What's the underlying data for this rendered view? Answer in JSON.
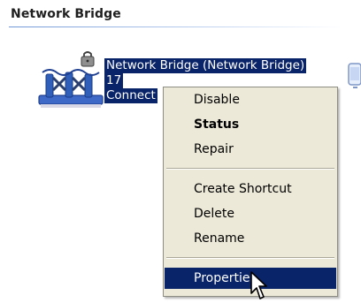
{
  "group": {
    "title": "Network Bridge"
  },
  "selected_item": {
    "name": "Network Bridge (Network Bridge)",
    "number": "17",
    "status": "Connect"
  },
  "context_menu": {
    "items": [
      {
        "label": "Disable"
      },
      {
        "label": "Status"
      },
      {
        "label": "Repair"
      },
      {
        "label": "Create Shortcut"
      },
      {
        "label": "Delete"
      },
      {
        "label": "Rename"
      },
      {
        "label": "Properties"
      }
    ]
  },
  "icons": {
    "bridge": "network-bridge-icon",
    "lock": "lock-icon",
    "neighbor": "network-connection-icon",
    "cursor": "mouse-pointer-icon"
  },
  "colors": {
    "selection": "#0a246a",
    "menu_background": "#ece9d8",
    "text": "#000000",
    "selection_text": "#ffffff"
  }
}
